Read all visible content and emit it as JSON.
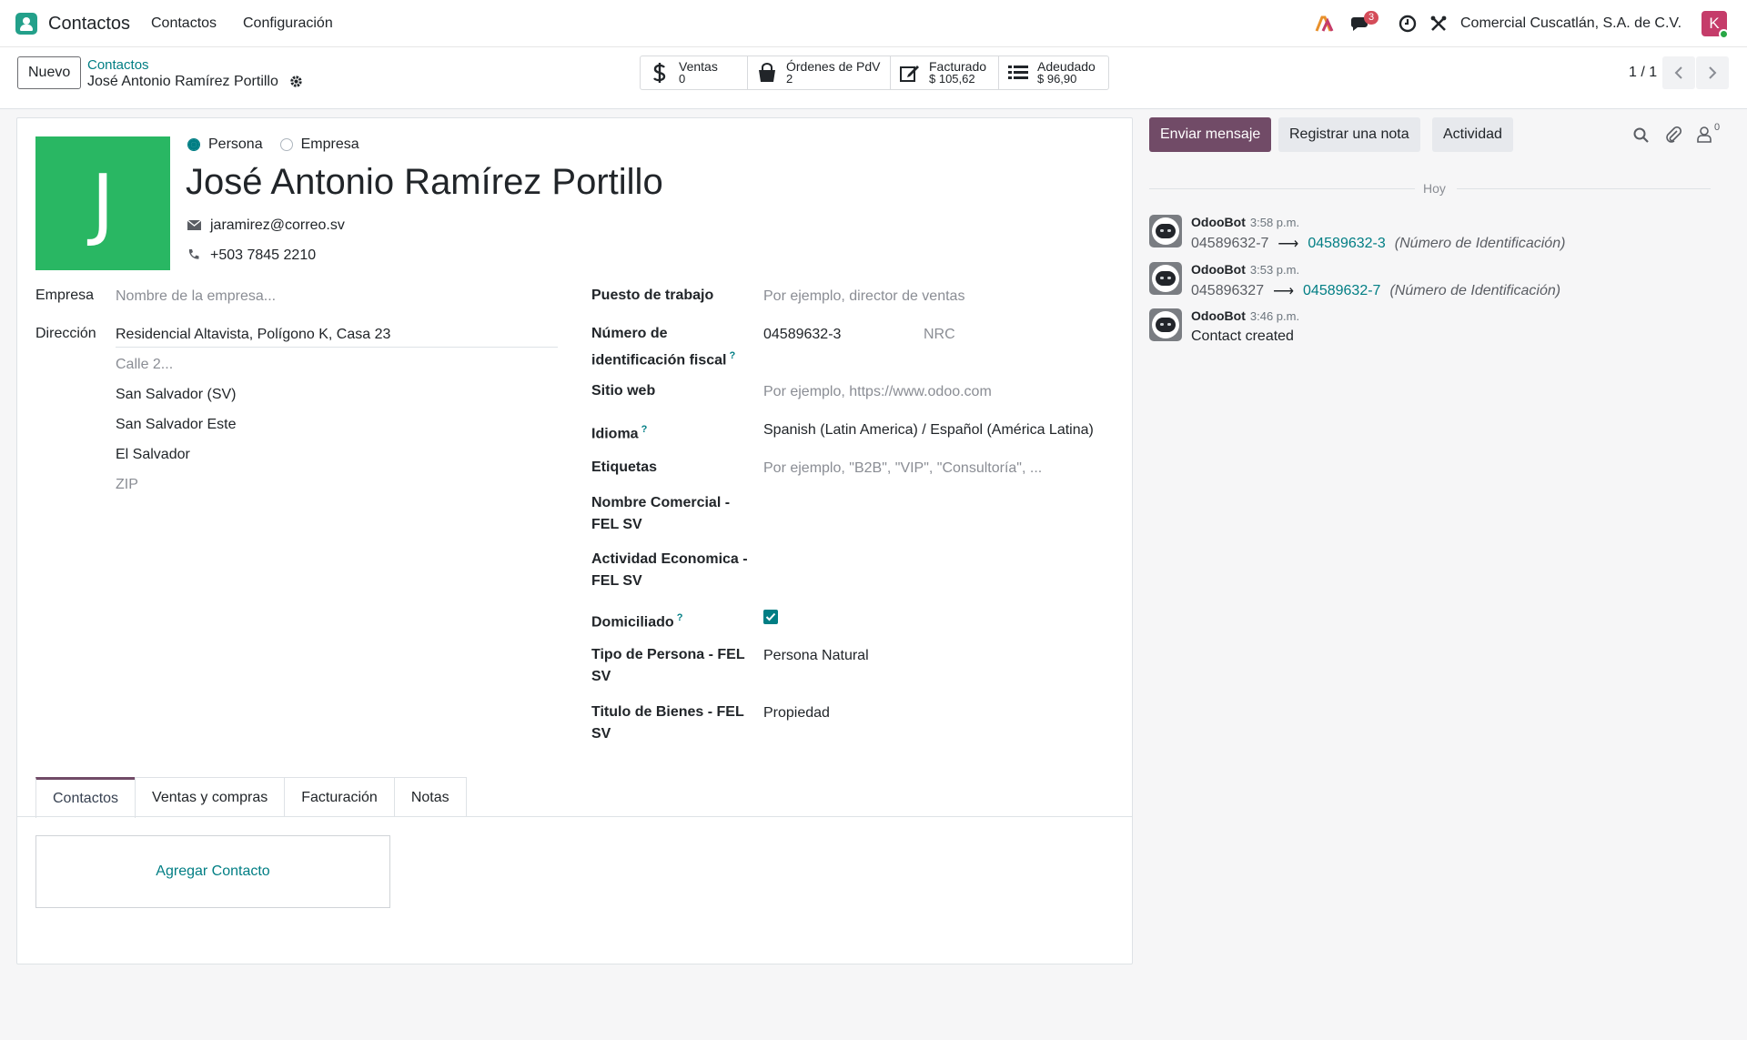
{
  "navbar": {
    "app_name": "Contactos",
    "menu": [
      "Contactos",
      "Configuración"
    ],
    "message_count": "3",
    "company": "Comercial Cuscatlán, S.A. de C.V.",
    "user_initial": "K"
  },
  "control": {
    "new_button": "Nuevo",
    "breadcrumb_parent": "Contactos",
    "breadcrumb_current": "José Antonio Ramírez Portillo",
    "smart_buttons": [
      {
        "label": "Ventas",
        "value": "0",
        "icon": "dollar-icon"
      },
      {
        "label": "Órdenes de PdV",
        "value": "2",
        "icon": "shopping-bag-icon"
      },
      {
        "label": "Facturado",
        "value": "$ 105,62",
        "icon": "pencil-square-icon"
      },
      {
        "label": "Adeudado",
        "value": "$ 96,90",
        "icon": "list-icon"
      }
    ],
    "pager": "1 / 1"
  },
  "form": {
    "avatar_letter": "J",
    "type_options": [
      "Persona",
      "Empresa"
    ],
    "type_selected": "Persona",
    "name": "José Antonio Ramírez Portillo",
    "email": "jaramirez@correo.sv",
    "phone": "+503 7845 2210",
    "company_label": "Empresa",
    "company_placeholder": "Nombre de la empresa...",
    "address_label": "Dirección",
    "street": "Residencial Altavista, Polígono K, Casa 23",
    "street2_placeholder": "Calle 2...",
    "state": "San Salvador (SV)",
    "city": "San Salvador Este",
    "country": "El Salvador",
    "zip_placeholder": "ZIP",
    "job_label": "Puesto de trabajo",
    "job_placeholder": "Por ejemplo, director de ventas",
    "vat_label_1": "Número de",
    "vat_label_2": "identificación fiscal",
    "vat_value": "04589632-3",
    "nrc_placeholder": "NRC",
    "website_label": "Sitio web",
    "website_placeholder": "Por ejemplo, https://www.odoo.com",
    "language_label": "Idioma",
    "language_value": "Spanish (Latin America) / Español (América Latina)",
    "tags_label": "Etiquetas",
    "tags_placeholder": "Por ejemplo, \"B2B\", \"VIP\", \"Consultoría\", ...",
    "commercial_name_label_1": "Nombre Comercial -",
    "commercial_name_label_2": "FEL SV",
    "activity_label_1": "Actividad Economica -",
    "activity_label_2": "FEL SV",
    "domiciled_label": "Domiciliado",
    "domiciled_checked": true,
    "person_type_label_1": "Tipo de Persona - FEL",
    "person_type_label_2": "SV",
    "person_type_value": "Persona Natural",
    "title_label_1": "Titulo de Bienes - FEL",
    "title_label_2": "SV",
    "title_value": "Propiedad",
    "help_mark": "?"
  },
  "tabs": [
    "Contactos",
    "Ventas y compras",
    "Facturación",
    "Notas"
  ],
  "active_tab": "Contactos",
  "add_contact": "Agregar Contacto",
  "chatter": {
    "send_message": "Enviar mensaje",
    "log_note": "Registrar una nota",
    "activity": "Actividad",
    "followers_count": "0",
    "date_separator": "Hoy",
    "messages": [
      {
        "author": "OdooBot",
        "time": "3:58 p.m.",
        "old": "04589632-7",
        "new": "04589632-3",
        "field": "(Número de Identificación)"
      },
      {
        "author": "OdooBot",
        "time": "3:53 p.m.",
        "old": "045896327",
        "new": "04589632-7",
        "field": "(Número de Identificación)"
      },
      {
        "author": "OdooBot",
        "time": "3:46 p.m.",
        "text": "Contact created"
      }
    ]
  },
  "colors": {
    "brand": "#714b67",
    "link": "#017e84",
    "avatar_bg": "#29b763"
  }
}
